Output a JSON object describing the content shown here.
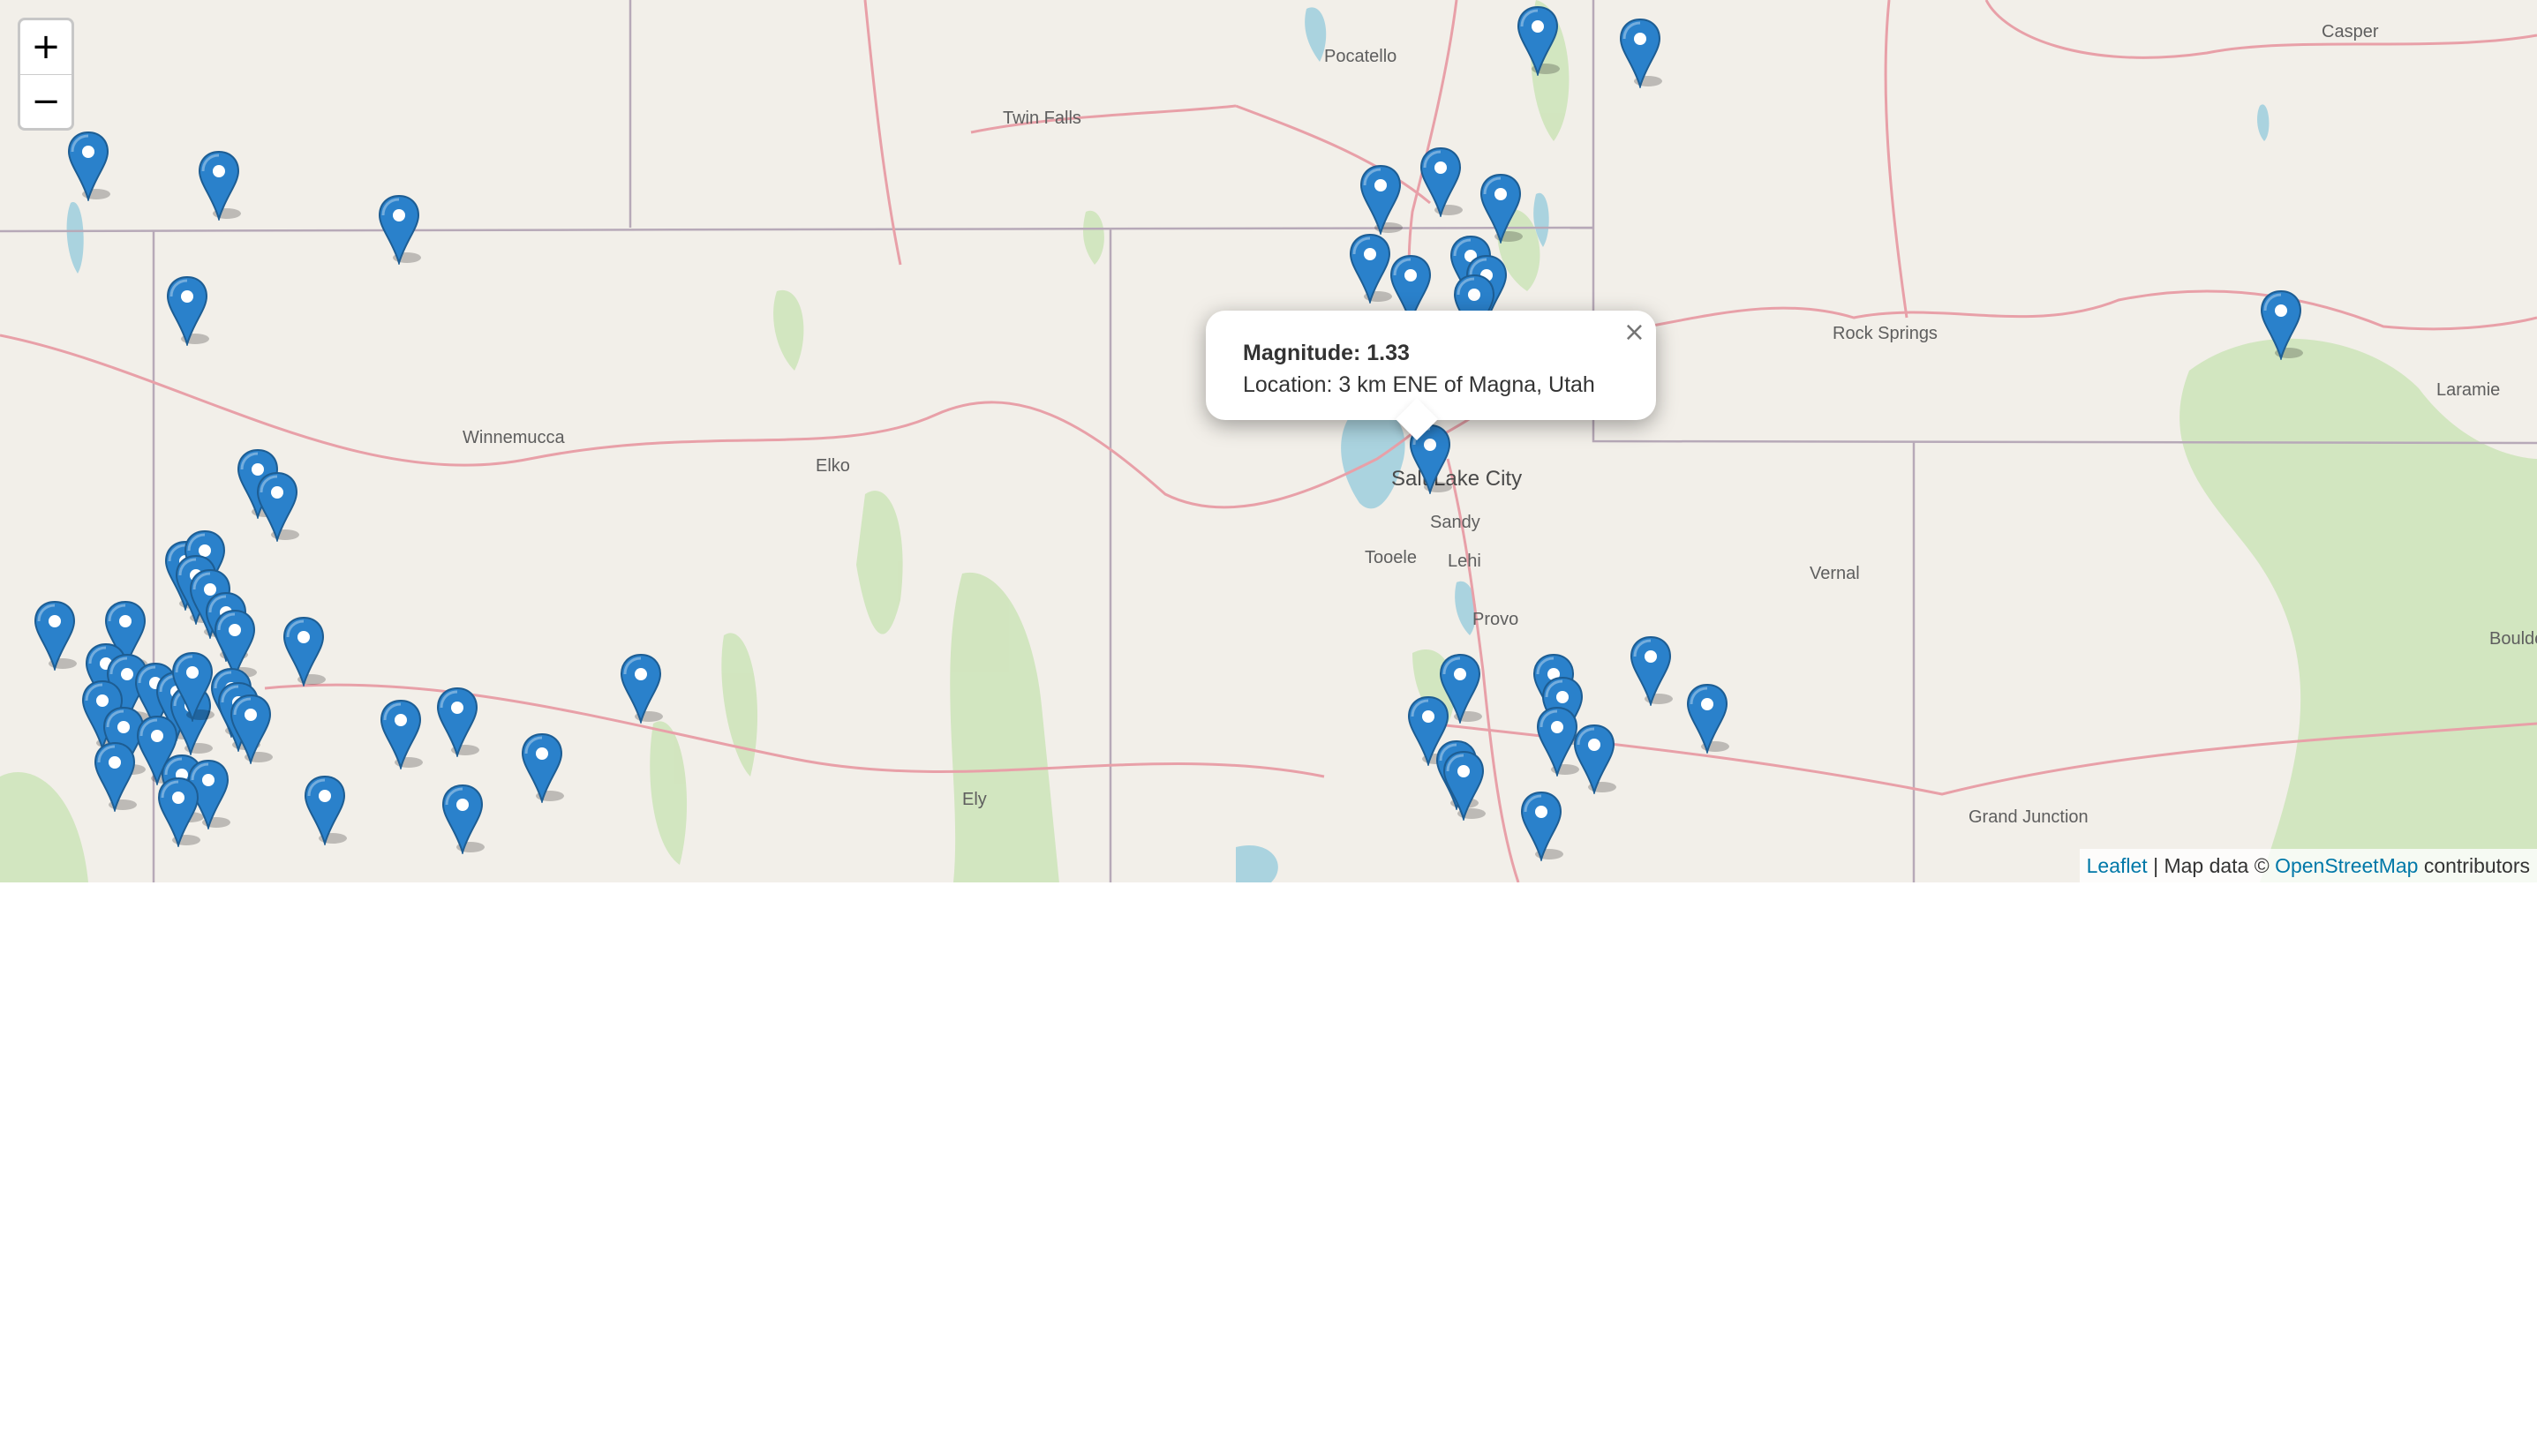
{
  "zoom": {
    "in_label": "+",
    "out_label": "−"
  },
  "popup": {
    "magnitude_label": "Magnitude:",
    "magnitude_value": "1.33",
    "location_label": "Location:",
    "location_value": "3 km ENE of Magna, Utah",
    "close_glyph": "×"
  },
  "attribution": {
    "leaflet_link": "Leaflet",
    "separator": "|",
    "map_data_text": "Map data ©",
    "osm_link": "OpenStreetMap",
    "contributors_text": "contributors"
  },
  "cities": [
    {
      "name": "Pocatello"
    },
    {
      "name": "Twin Falls"
    },
    {
      "name": "Casper"
    },
    {
      "name": "Rock Springs"
    },
    {
      "name": "Laramie"
    },
    {
      "name": "Winnemucca"
    },
    {
      "name": "Elko"
    },
    {
      "name": "Salt Lake City"
    },
    {
      "name": "Sandy"
    },
    {
      "name": "Tooele"
    },
    {
      "name": "Lehi"
    },
    {
      "name": "Provo"
    },
    {
      "name": "Vernal"
    },
    {
      "name": "Ely"
    },
    {
      "name": "Grand Junction"
    },
    {
      "name": "Boulder"
    }
  ],
  "marker_icon": "map-marker-icon",
  "colors": {
    "marker": "#2a81cb",
    "map_background": "#f2efe9",
    "state_border": "#b7a9b8",
    "highway": "#e8a0a8",
    "water": "#aad3df",
    "forest": "#cde4b8",
    "link": "#0078a8"
  }
}
